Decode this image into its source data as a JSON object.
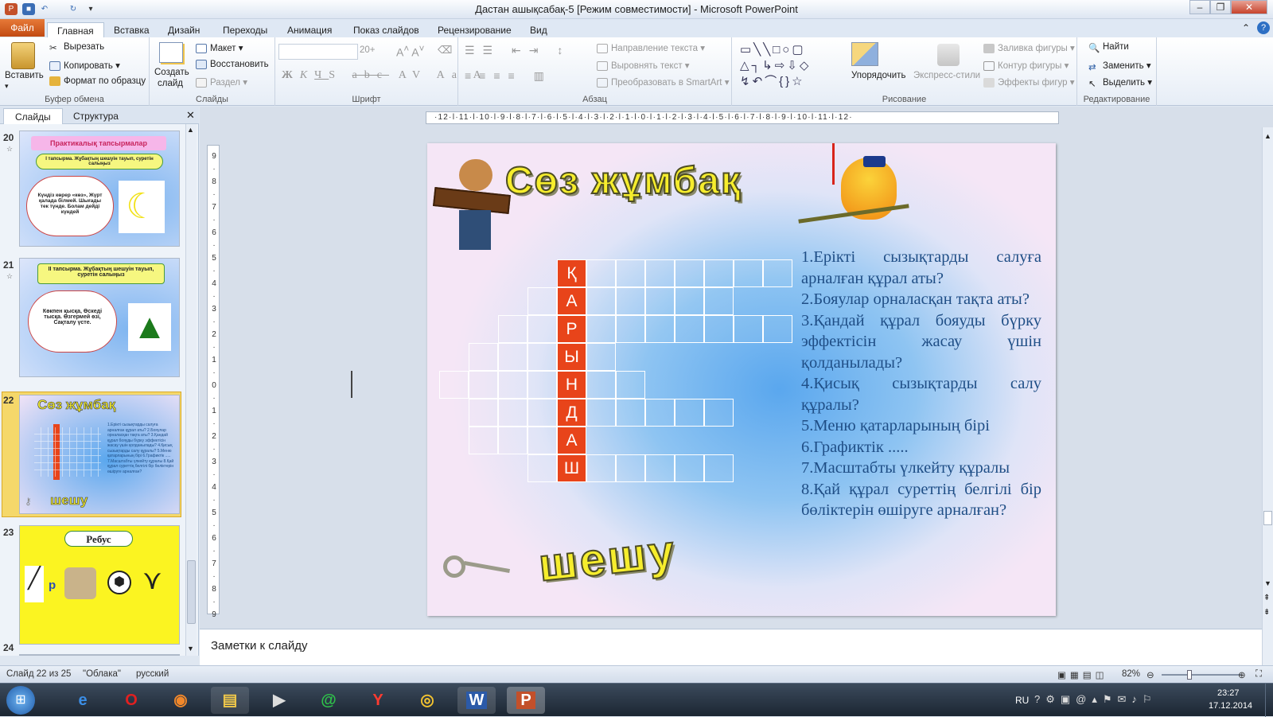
{
  "window": {
    "title": "Дастан ашықсабақ-5 [Режим совместимости]  -  Microsoft PowerPoint"
  },
  "tabs": [
    "Файл",
    "Главная",
    "Вставка",
    "Дизайн",
    "Переходы",
    "Анимация",
    "Показ слайдов",
    "Рецензирование",
    "Вид"
  ],
  "ribbon": {
    "clipboard": {
      "paste": "Вставить",
      "cut": "Вырезать",
      "copy": "Копировать",
      "format": "Формат по образцу",
      "label": "Буфер обмена"
    },
    "slides": {
      "create": "Создать",
      "create2": "слайд",
      "layout": "Макет",
      "restore": "Восстановить",
      "section": "Раздел",
      "label": "Слайды"
    },
    "font": {
      "size": "20+",
      "label": "Шрифт"
    },
    "paragraph": {
      "direction": "Направление текста",
      "align": "Выровнять текст",
      "smartart": "Преобразовать в SmartArt",
      "label": "Абзац"
    },
    "drawing": {
      "arrange": "Упорядочить",
      "styles": "Экспресс-стили",
      "fill": "Заливка фигуры",
      "outline": "Контур фигуры",
      "effects": "Эффекты фигур",
      "label": "Рисование"
    },
    "editing": {
      "find": "Найти",
      "replace": "Заменить",
      "select": "Выделить",
      "label": "Редактирование"
    }
  },
  "left_pane": {
    "tabs": [
      "Слайды",
      "Структура"
    ],
    "thumbs": [
      {
        "num": "20",
        "title": "Практикалық тапсырмалар",
        "subtitle": "І тапсырма. Жұбақтың шешуін тауып, суретін салыңыз",
        "poem": "Күндіз көрер «көз», Жүрт қалада білмей. Шығады тек түнде. Болам дейді күндей"
      },
      {
        "num": "21",
        "title": "ІІ тапсырма. Жұбақтың шешуін тауып, суретін салыңыз",
        "poem": "Көкпен қысқа, Өскеді тысқа. Өзгермей өзі, Сақталу үсте."
      },
      {
        "num": "22",
        "title": "Сөз жұмбақ",
        "word": "шешу"
      },
      {
        "num": "23",
        "title": "Ребус",
        "letter": "р"
      },
      {
        "num": "24"
      }
    ]
  },
  "slide": {
    "title": "Сөз жұмбақ",
    "answer_word": "шешу",
    "crossword_letters": [
      "Қ",
      "А",
      "Р",
      "Ы",
      "Н",
      "Д",
      "А",
      "Ш"
    ],
    "questions": [
      "1.Ерікті сызықтарды салуға арналған құрал аты?",
      "2.Бояулар орналасқан тақта аты?",
      "3.Қандай құрал бояуды бүрку эффектісін жасау үшін қолданылады?",
      "4.Қисық сызықтарды салу құралы?",
      "5.Меню қатарларының бірі",
      "6.Графиктік .....",
      "7.Масштабты үлкейту құралы",
      "8.Қай құрал суреттің белгілі бір бөліктерін өшіруге арналған?"
    ]
  },
  "notes": {
    "placeholder": "Заметки к слайду"
  },
  "status": {
    "slide": "Слайд 22 из 25",
    "theme": "\"Облака\"",
    "lang": "русский",
    "zoom": "82%"
  },
  "taskbar": {
    "lang": "RU",
    "time": "23:27",
    "date": "17.12.2014"
  }
}
